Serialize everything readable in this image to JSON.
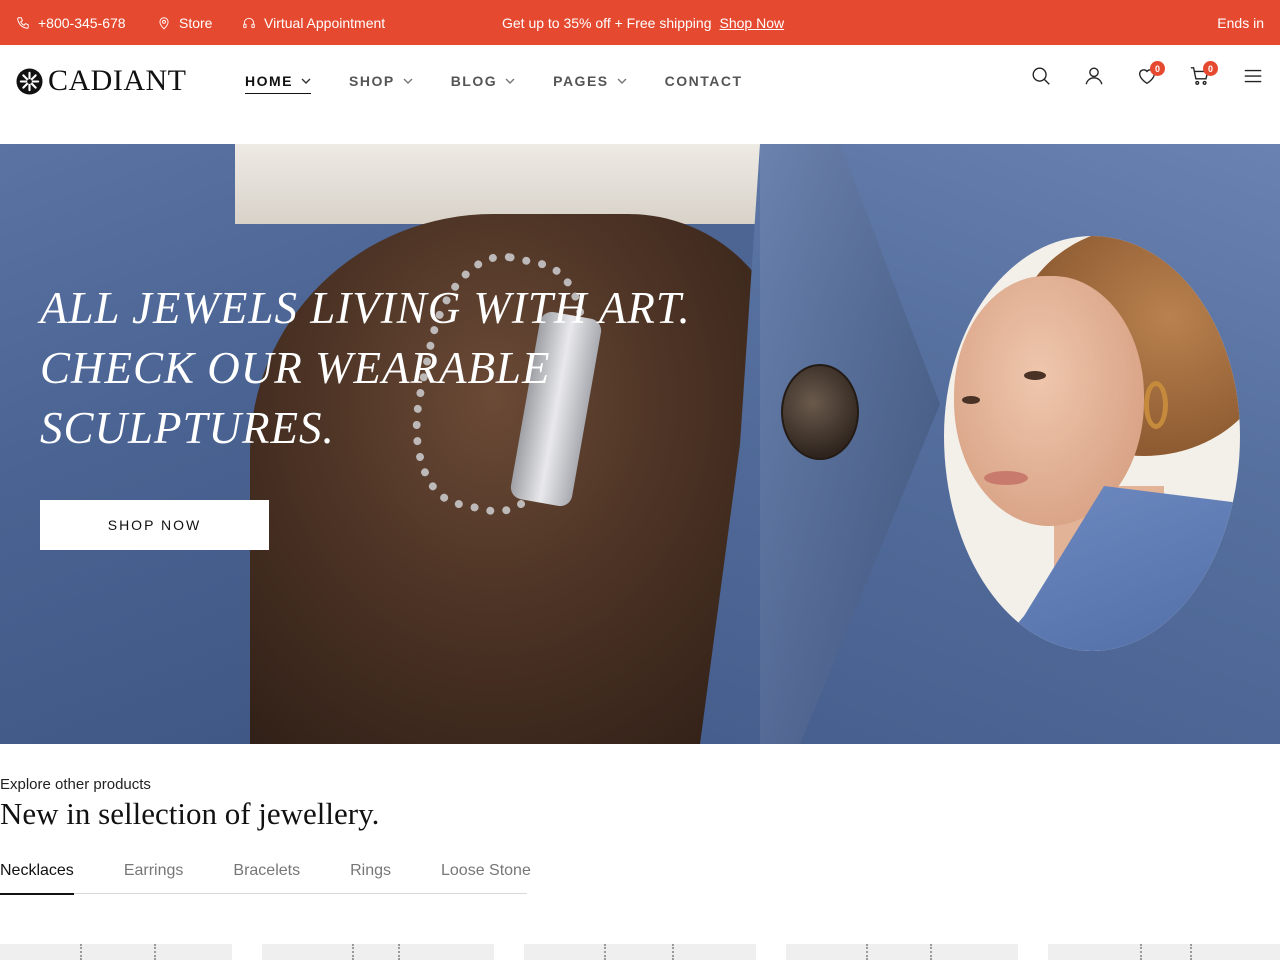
{
  "topbar": {
    "phone": "+800-345-678",
    "store": "Store",
    "virtual": "Virtual Appointment",
    "promo_text": "Get up to 35% off + Free shipping",
    "promo_link": "Shop Now",
    "ends": "Ends in",
    "background": "#e54a30"
  },
  "header": {
    "logo": "CADIANT",
    "nav": [
      {
        "label": "HOME",
        "active": true,
        "has_dropdown": true
      },
      {
        "label": "SHOP",
        "active": false,
        "has_dropdown": true
      },
      {
        "label": "BLOG",
        "active": false,
        "has_dropdown": true
      },
      {
        "label": "PAGES",
        "active": false,
        "has_dropdown": true
      },
      {
        "label": "CONTACT",
        "active": false,
        "has_dropdown": false
      }
    ],
    "icons": [
      "search-icon",
      "user-icon",
      "heart-icon",
      "cart-icon",
      "menu-icon"
    ],
    "wishlist_count": "0",
    "cart_count": "0"
  },
  "hero": {
    "headline": [
      "ALL JEWELS LIVING WITH ART.",
      "CHECK OUR WEARABLE",
      "SCULPTURES."
    ],
    "button": "SHOP NOW"
  },
  "products": {
    "subtitle": "Explore other products",
    "title": "New in sellection of jewellery.",
    "tabs": [
      {
        "label": "Necklaces",
        "active": true
      },
      {
        "label": "Earrings",
        "active": false
      },
      {
        "label": "Bracelets",
        "active": false
      },
      {
        "label": "Rings",
        "active": false
      },
      {
        "label": "Loose Stone",
        "active": false
      }
    ]
  },
  "colors": {
    "accent": "#e54a30",
    "text": "#111111"
  }
}
